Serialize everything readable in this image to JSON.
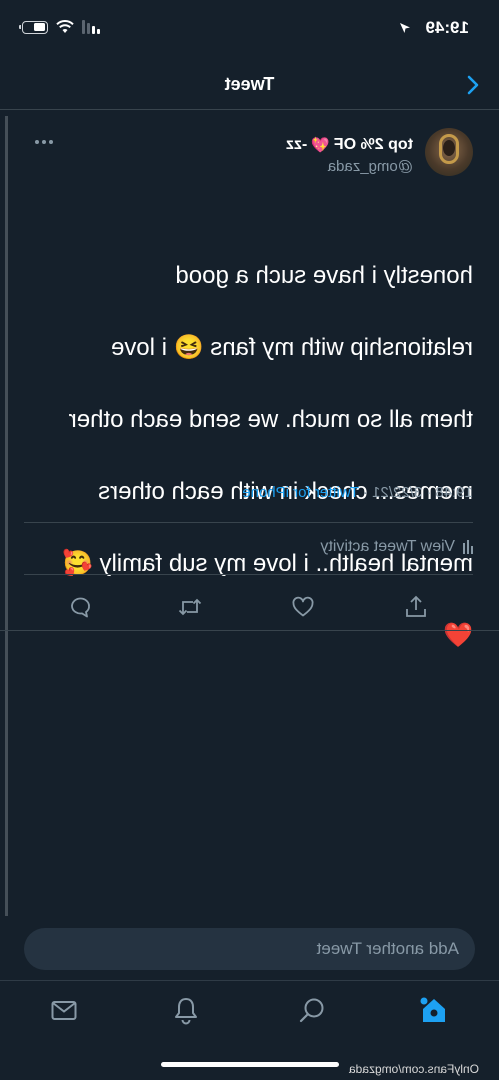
{
  "status_bar": {
    "time": "19:49"
  },
  "header": {
    "title": "Tweet"
  },
  "tweet": {
    "display_name": "top 2% OF",
    "display_name_suffix": "-zz",
    "heart_emoji": "💖",
    "username": "@omg_zada",
    "text_lines": [
      "honestly i have such a good",
      "relationship with my fans 😆 i love",
      "them all so much. we send each other",
      "memes... check in with each others",
      "mental health.. i love my sub family 🥰",
      "❤️"
    ],
    "timestamp": "19:48 · 3/22/21 · ",
    "source": "Twitter for iPhone",
    "activity_label": "View Tweet activity"
  },
  "composer": {
    "placeholder": "Add another Tweet"
  },
  "watermark": "OnlyFans.com/omgzada",
  "colors": {
    "background": "#15202b",
    "accent": "#1da1f2",
    "secondary_text": "#8899a6",
    "divider": "#38444d"
  },
  "icons": {
    "back": "chevron-left-icon",
    "more": "more-dots-icon",
    "reply": "reply-icon",
    "retweet": "retweet-icon",
    "like": "heart-icon",
    "share": "share-icon",
    "home": "home-icon",
    "search": "search-icon",
    "notifications": "bell-icon",
    "messages": "envelope-icon"
  }
}
